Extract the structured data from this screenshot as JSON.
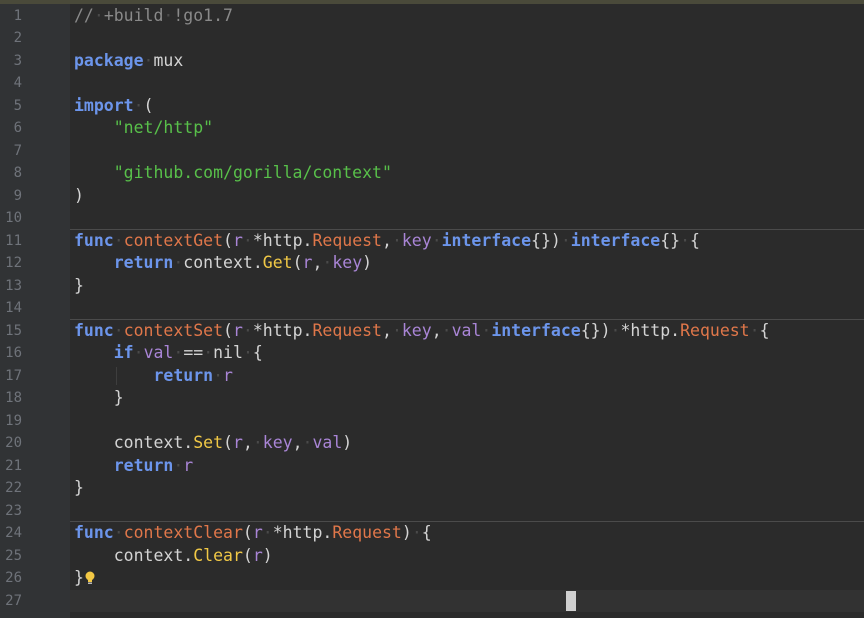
{
  "editor": {
    "current_line": 27,
    "lines": [
      {
        "n": "1",
        "tokens": [
          [
            "cm",
            "//"
          ],
          [
            "ws",
            "·"
          ],
          [
            "cm",
            "+build"
          ],
          [
            "ws",
            "·"
          ],
          [
            "cm",
            "!go1.7"
          ]
        ]
      },
      {
        "n": "2",
        "tokens": []
      },
      {
        "n": "3",
        "tokens": [
          [
            "kw",
            "package"
          ],
          [
            "ws",
            "·"
          ],
          [
            "pl",
            "mux"
          ]
        ]
      },
      {
        "n": "4",
        "tokens": []
      },
      {
        "n": "5",
        "tokens": [
          [
            "kw",
            "import"
          ],
          [
            "ws",
            "·"
          ],
          [
            "pl",
            "("
          ]
        ]
      },
      {
        "n": "6",
        "tokens": [
          [
            "pl",
            "    "
          ],
          [
            "st",
            "\"net/http\""
          ]
        ]
      },
      {
        "n": "7",
        "tokens": []
      },
      {
        "n": "8",
        "tokens": [
          [
            "pl",
            "    "
          ],
          [
            "st",
            "\"github.com/gorilla/context\""
          ]
        ]
      },
      {
        "n": "9",
        "tokens": [
          [
            "pl",
            ")"
          ]
        ]
      },
      {
        "n": "10",
        "tokens": []
      },
      {
        "n": "11",
        "tokens": [
          [
            "kw",
            "func"
          ],
          [
            "ws",
            "·"
          ],
          [
            "fn",
            "contextGet"
          ],
          [
            "pl",
            "("
          ],
          [
            "pa",
            "r"
          ],
          [
            "ws",
            "·"
          ],
          [
            "pl",
            "*http."
          ],
          [
            "ty",
            "Request"
          ],
          [
            "pl",
            ","
          ],
          [
            "ws",
            "·"
          ],
          [
            "pa",
            "key"
          ],
          [
            "ws",
            "·"
          ],
          [
            "kw",
            "interface"
          ],
          [
            "pl",
            "{})"
          ],
          [
            "ws",
            "·"
          ],
          [
            "kw",
            "interface"
          ],
          [
            "pl",
            "{}"
          ],
          [
            "ws",
            "·"
          ],
          [
            "pl",
            "{"
          ]
        ]
      },
      {
        "n": "12",
        "tokens": [
          [
            "pl",
            "    "
          ],
          [
            "kw",
            "return"
          ],
          [
            "ws",
            "·"
          ],
          [
            "pl",
            "context."
          ],
          [
            "mc",
            "Get"
          ],
          [
            "pl",
            "("
          ],
          [
            "pa",
            "r"
          ],
          [
            "pl",
            ","
          ],
          [
            "ws",
            "·"
          ],
          [
            "pa",
            "key"
          ],
          [
            "pl",
            ")"
          ]
        ]
      },
      {
        "n": "13",
        "tokens": [
          [
            "pl",
            "}"
          ]
        ]
      },
      {
        "n": "14",
        "tokens": []
      },
      {
        "n": "15",
        "tokens": [
          [
            "kw",
            "func"
          ],
          [
            "ws",
            "·"
          ],
          [
            "fn",
            "contextSet"
          ],
          [
            "pl",
            "("
          ],
          [
            "pa",
            "r"
          ],
          [
            "ws",
            "·"
          ],
          [
            "pl",
            "*http."
          ],
          [
            "ty",
            "Request"
          ],
          [
            "pl",
            ","
          ],
          [
            "ws",
            "·"
          ],
          [
            "pa",
            "key"
          ],
          [
            "pl",
            ","
          ],
          [
            "ws",
            "·"
          ],
          [
            "pa",
            "val"
          ],
          [
            "ws",
            "·"
          ],
          [
            "kw",
            "interface"
          ],
          [
            "pl",
            "{})"
          ],
          [
            "ws",
            "·"
          ],
          [
            "pl",
            "*http."
          ],
          [
            "ty",
            "Request"
          ],
          [
            "ws",
            "·"
          ],
          [
            "pl",
            "{"
          ]
        ]
      },
      {
        "n": "16",
        "tokens": [
          [
            "pl",
            "    "
          ],
          [
            "kw",
            "if"
          ],
          [
            "ws",
            "·"
          ],
          [
            "pa",
            "val"
          ],
          [
            "ws",
            "·"
          ],
          [
            "pl",
            "=="
          ],
          [
            "ws",
            "·"
          ],
          [
            "pl",
            "nil"
          ],
          [
            "ws",
            "·"
          ],
          [
            "pl",
            "{"
          ]
        ]
      },
      {
        "n": "17",
        "tokens": [
          [
            "pl",
            "        "
          ],
          [
            "kw",
            "return"
          ],
          [
            "ws",
            "·"
          ],
          [
            "pa",
            "r"
          ]
        ]
      },
      {
        "n": "18",
        "tokens": [
          [
            "pl",
            "    }"
          ]
        ]
      },
      {
        "n": "19",
        "tokens": []
      },
      {
        "n": "20",
        "tokens": [
          [
            "pl",
            "    context."
          ],
          [
            "mc",
            "Set"
          ],
          [
            "pl",
            "("
          ],
          [
            "pa",
            "r"
          ],
          [
            "pl",
            ","
          ],
          [
            "ws",
            "·"
          ],
          [
            "pa",
            "key"
          ],
          [
            "pl",
            ","
          ],
          [
            "ws",
            "·"
          ],
          [
            "pa",
            "val"
          ],
          [
            "pl",
            ")"
          ]
        ]
      },
      {
        "n": "21",
        "tokens": [
          [
            "pl",
            "    "
          ],
          [
            "kw",
            "return"
          ],
          [
            "ws",
            "·"
          ],
          [
            "pa",
            "r"
          ]
        ]
      },
      {
        "n": "22",
        "tokens": [
          [
            "pl",
            "}"
          ]
        ]
      },
      {
        "n": "23",
        "tokens": []
      },
      {
        "n": "24",
        "tokens": [
          [
            "kw",
            "func"
          ],
          [
            "ws",
            "·"
          ],
          [
            "fn",
            "contextClear"
          ],
          [
            "pl",
            "("
          ],
          [
            "pa",
            "r"
          ],
          [
            "ws",
            "·"
          ],
          [
            "pl",
            "*http."
          ],
          [
            "ty",
            "Request"
          ],
          [
            "pl",
            ")"
          ],
          [
            "ws",
            "·"
          ],
          [
            "pl",
            "{"
          ]
        ]
      },
      {
        "n": "25",
        "tokens": [
          [
            "pl",
            "    context."
          ],
          [
            "mc",
            "Clear"
          ],
          [
            "pl",
            "("
          ],
          [
            "pa",
            "r"
          ],
          [
            "pl",
            ")"
          ]
        ]
      },
      {
        "n": "26",
        "tokens": [
          [
            "pl",
            "}"
          ]
        ]
      },
      {
        "n": "27",
        "tokens": []
      }
    ]
  },
  "colors": {
    "keyword": "#6c95eb",
    "function": "#e0774a",
    "parameter": "#a985d6",
    "string": "#58c04a",
    "comment": "#8a8a8a",
    "method": "#f0c846",
    "background": "#2b2b2b",
    "gutter": "#313335"
  },
  "icons": {
    "intention": "lightbulb-icon"
  }
}
